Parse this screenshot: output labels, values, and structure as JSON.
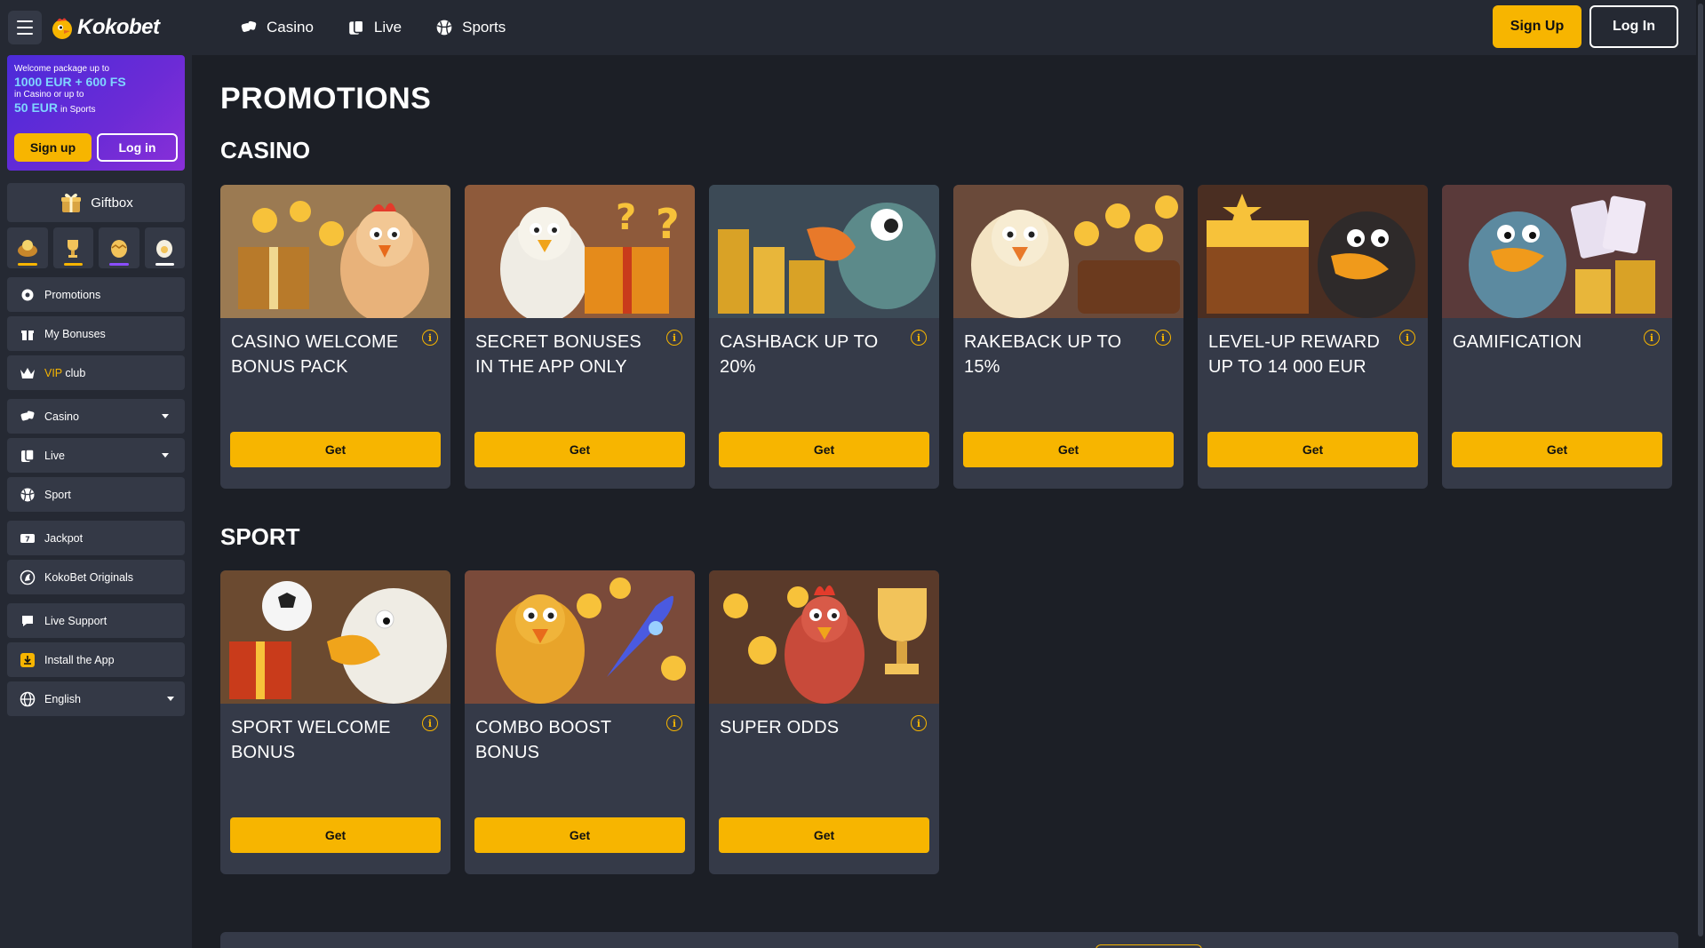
{
  "brand": {
    "name": "Kokobet"
  },
  "banner": {
    "line1": "Welcome package up to",
    "line2": "1000 EUR + 600 FS",
    "line3": "in Casino or up to",
    "line4_big": "50 EUR",
    "line4_small": "in Sports",
    "signup_label": "Sign up",
    "login_label": "Log in"
  },
  "giftbox": {
    "label": "Giftbox",
    "tiles": [
      {
        "icon": "gift-bowl-icon",
        "bar_color": "#f7b500"
      },
      {
        "icon": "gift-trophy-icon",
        "bar_color": "#f7b500"
      },
      {
        "icon": "gift-egg-icon",
        "bar_color": "#8a4dff"
      },
      {
        "icon": "gift-white-egg-icon",
        "bar_color": "#ffffff"
      }
    ]
  },
  "sidebar": {
    "group1": [
      {
        "label": "Promotions",
        "icon": "promotions-icon"
      },
      {
        "label": "My Bonuses",
        "icon": "bonuses-icon"
      },
      {
        "label_vip": "VIP",
        "label_rest": " club",
        "icon": "crown-icon"
      }
    ],
    "group2": [
      {
        "label": "Casino",
        "icon": "casino-icon",
        "dropdown": true
      },
      {
        "label": "Live",
        "icon": "live-icon",
        "dropdown": true
      },
      {
        "label": "Sport",
        "icon": "sport-icon",
        "dropdown": false
      }
    ],
    "group3": [
      {
        "label": "Jackpot",
        "icon": "jackpot-icon"
      },
      {
        "label": "KokoBet Originals",
        "icon": "originals-icon"
      }
    ],
    "group4": [
      {
        "label": "Live Support",
        "icon": "support-icon"
      },
      {
        "label": "Install the App",
        "icon": "download-icon"
      },
      {
        "label": "English",
        "icon": "globe-icon",
        "dropdown": true
      }
    ]
  },
  "topnav": {
    "items": [
      {
        "label": "Casino",
        "icon": "casino-icon"
      },
      {
        "label": "Live",
        "icon": "live-icon"
      },
      {
        "label": "Sports",
        "icon": "sports-ball-icon"
      }
    ],
    "signup_label": "Sign Up",
    "login_label": "Log In"
  },
  "main": {
    "title": "PROMOTIONS",
    "casino_section": "CASINO",
    "sport_section": "SPORT",
    "casino_cards": [
      {
        "title": "Casino Welcome Bonus Pack",
        "button": "Get"
      },
      {
        "title": "Secret Bonuses in the App Only",
        "button": "Get"
      },
      {
        "title": "Cashback up to 20%",
        "button": "Get"
      },
      {
        "title": "Rakeback up to 15%",
        "button": "Get"
      },
      {
        "title": "Level-up reward up to 14 000 EUR",
        "button": "Get"
      },
      {
        "title": "Gamification",
        "button": "Get"
      }
    ],
    "sport_cards": [
      {
        "title": "Sport Welcome Bonus",
        "button": "Get"
      },
      {
        "title": "Combo Boost Bonus",
        "button": "Get"
      },
      {
        "title": "Super Odds",
        "button": "Get"
      }
    ]
  },
  "colors": {
    "accent": "#f7b500",
    "bg": "#1c1f26",
    "panel": "#252933",
    "card": "#353a48"
  }
}
